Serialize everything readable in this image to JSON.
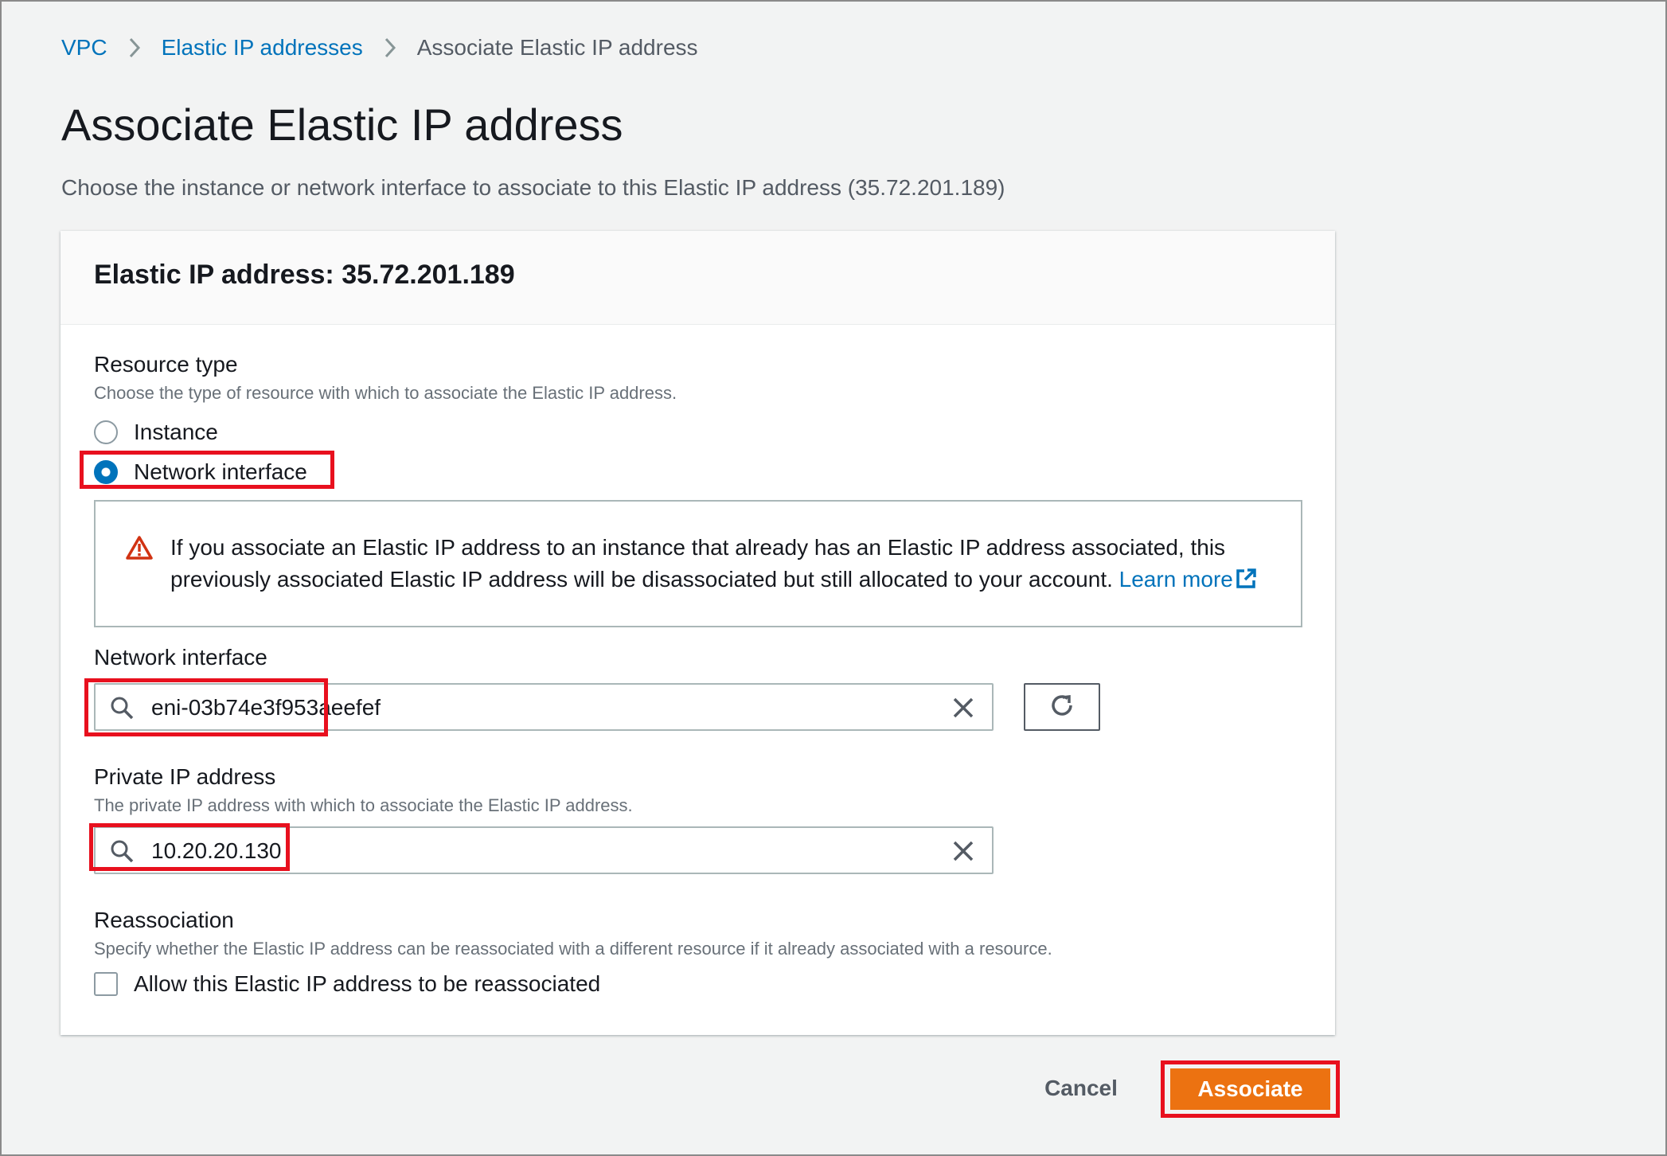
{
  "breadcrumb": {
    "items": [
      "VPC",
      "Elastic IP addresses"
    ],
    "current": "Associate Elastic IP address"
  },
  "page": {
    "title": "Associate Elastic IP address",
    "description": "Choose the instance or network interface to associate to this Elastic IP address (35.72.201.189)"
  },
  "panel": {
    "title": "Elastic IP address: 35.72.201.189"
  },
  "resource_type": {
    "label": "Resource type",
    "hint": "Choose the type of resource with which to associate the Elastic IP address.",
    "options": [
      {
        "label": "Instance",
        "checked": false
      },
      {
        "label": "Network interface",
        "checked": true
      }
    ]
  },
  "alert": {
    "icon": "warning-icon",
    "text": "If you associate an Elastic IP address to an instance that already has an Elastic IP address associated, this previously associated Elastic IP address will be disassociated but still allocated to your account.",
    "link": "Learn more"
  },
  "network_interface": {
    "label": "Network interface",
    "value": "eni-03b74e3f953aeefef",
    "search_icon": "search-icon",
    "clear_icon": "close-icon",
    "refresh_icon": "refresh-icon"
  },
  "private_ip": {
    "label": "Private IP address",
    "hint": "The private IP address with which to associate the Elastic IP address.",
    "value": "10.20.20.130"
  },
  "reassociation": {
    "label": "Reassociation",
    "hint": "Specify whether the Elastic IP address can be reassociated with a different resource if it already associated with a resource.",
    "checkbox_label": "Allow this Elastic IP address to be reassociated",
    "checked": false
  },
  "actions": {
    "cancel": "Cancel",
    "associate": "Associate"
  },
  "colors": {
    "link": "#0073bb",
    "primary": "#ec7211",
    "highlight": "#e8101e",
    "warning": "#d13212"
  }
}
